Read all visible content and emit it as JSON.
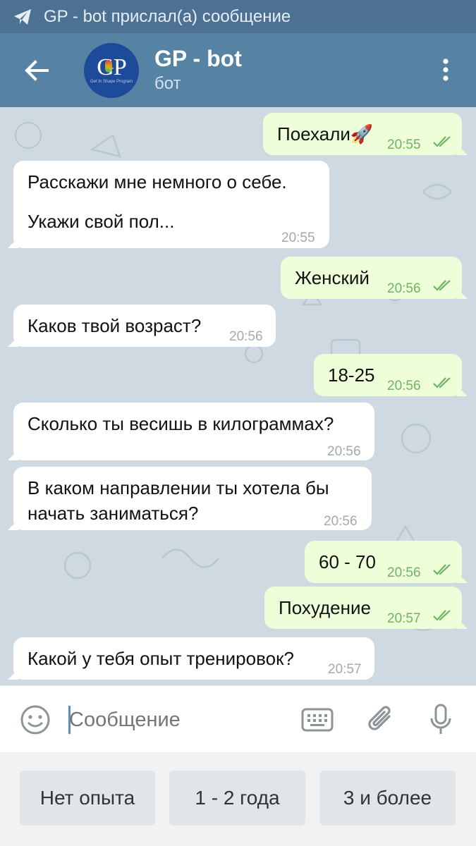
{
  "notification": {
    "text": "GP - bot прислал(а) сообщение"
  },
  "header": {
    "title": "GP - bot",
    "subtitle": "бот",
    "avatar_text": "GP",
    "avatar_sub": "Get In Shape Program"
  },
  "messages": [
    {
      "dir": "out",
      "text": "Поехали🚀",
      "time": "20:55"
    },
    {
      "dir": "in",
      "line1": "Расскажи мне немного о себе.",
      "line2": "Укажи свой пол...",
      "time": "20:55"
    },
    {
      "dir": "out",
      "text": "Женский",
      "time": "20:56"
    },
    {
      "dir": "in",
      "text": "Каков твой возраст?",
      "time": "20:56"
    },
    {
      "dir": "out",
      "text": "18-25",
      "time": "20:56"
    },
    {
      "dir": "in",
      "text": "Сколько ты весишь в килограммах?",
      "time": "20:56"
    },
    {
      "dir": "in",
      "line1": "В каком направлении ты хотела бы",
      "line2": "начать заниматься?",
      "time": "20:56"
    },
    {
      "dir": "out",
      "text": "60 - 70",
      "time": "20:56"
    },
    {
      "dir": "out",
      "text": "Похудение",
      "time": "20:57"
    },
    {
      "dir": "in",
      "text": "Какой у тебя опыт тренировок?",
      "time": "20:57"
    }
  ],
  "input": {
    "placeholder": "Сообщение"
  },
  "keyboard": {
    "buttons": [
      "Нет опыта",
      "1 - 2 года",
      "3 и более"
    ]
  },
  "colors": {
    "header": "#5682a3",
    "status_bar": "#4d7192",
    "outgoing_bubble": "#eefed9",
    "incoming_bubble": "#ffffff",
    "outgoing_time": "#71b263"
  }
}
